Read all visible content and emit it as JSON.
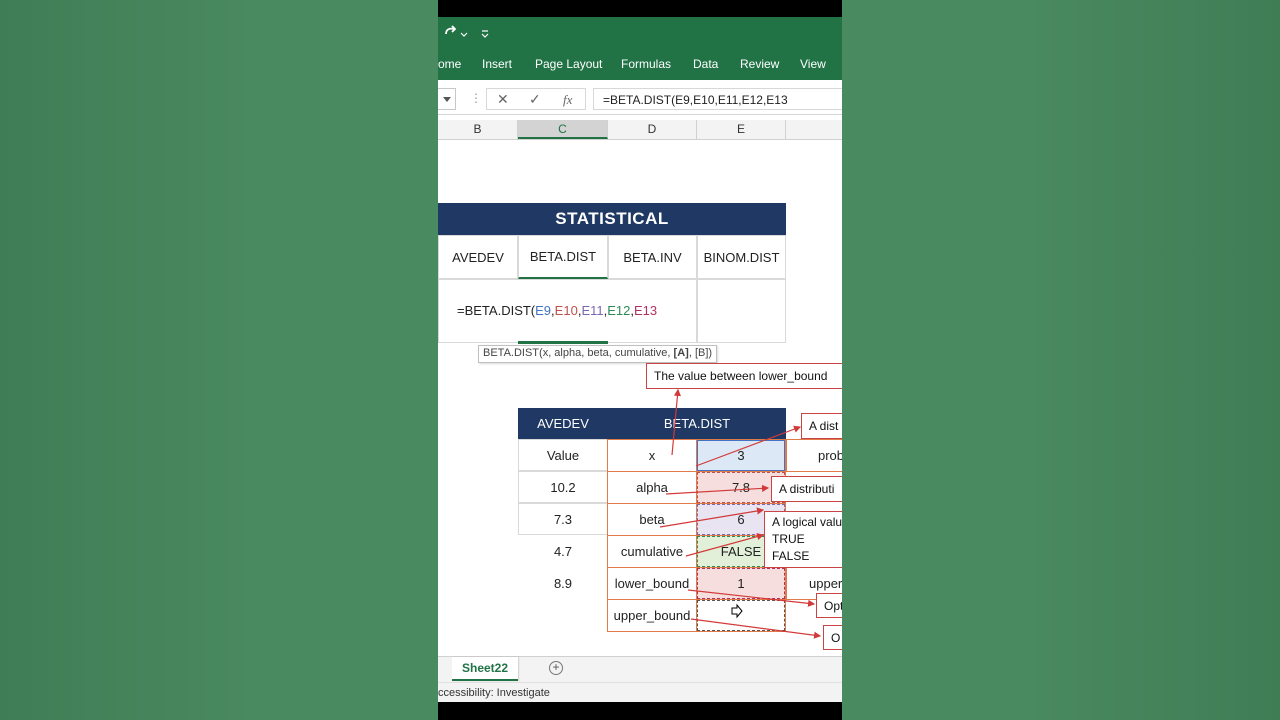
{
  "quick_access": {
    "redo_icon": "redo-icon",
    "dropdown_icon": "chevron-down-icon",
    "customize_icon": "customize-icon"
  },
  "ribbon": {
    "tabs": [
      "ome",
      "Insert",
      "Page Layout",
      "Formulas",
      "Data",
      "Review",
      "View"
    ]
  },
  "formula_bar": {
    "cancel_glyph": "✕",
    "enter_glyph": "✓",
    "fx_glyph": "fx",
    "formula": "=BETA.DIST(E9,E10,E11,E12,E13"
  },
  "columns": [
    "B",
    "C",
    "D",
    "E"
  ],
  "table1": {
    "title": "STATISTICAL",
    "headers": [
      "AVEDEV",
      "BETA.DIST",
      "BETA.INV",
      "BINOM.DIST"
    ],
    "formula_prefix": "=BETA.DIST(",
    "refs": [
      {
        "text": "E9",
        "color": "#4472c4"
      },
      {
        "text": ",",
        "color": "#222222"
      },
      {
        "text": "E10",
        "color": "#c0504d"
      },
      {
        "text": ",",
        "color": "#222222"
      },
      {
        "text": "E11",
        "color": "#7b68b0"
      },
      {
        "text": ",",
        "color": "#222222"
      },
      {
        "text": "E12",
        "color": "#2e8b57"
      },
      {
        "text": ",",
        "color": "#222222"
      },
      {
        "text": "E13",
        "color": "#b03060"
      }
    ]
  },
  "tooltip": {
    "prefix": "BETA.DIST(x, alpha, beta, cumulative, ",
    "bold": "[A]",
    "suffix": ", [B])"
  },
  "table2": {
    "header_left": "AVEDEV",
    "header_right": "BETA.DIST",
    "col_b": [
      "Value",
      "10.2",
      "7.3",
      "4.7",
      "8.9"
    ],
    "params": [
      "x",
      "alpha",
      "beta",
      "cumulative",
      "lower_bound",
      "upper_bound"
    ],
    "values": [
      "3",
      "7.8",
      "6",
      "FALSE",
      "1",
      ""
    ],
    "col_f": [
      "prob",
      "",
      "",
      "",
      "upper",
      ""
    ]
  },
  "callouts": {
    "c1": "The value between lower_bound",
    "c2": "A dist",
    "c3": "A distributi",
    "c4_lines": [
      "A logical valu",
      "TRUE",
      "FALSE"
    ],
    "c5": "Opt",
    "c6": "O"
  },
  "sheet": {
    "active_tab": "Sheet22",
    "add_glyph": "+"
  },
  "status": {
    "text": "ccessibility: Investigate"
  },
  "colors": {
    "excel_green": "#217346",
    "header_navy": "#1f3864",
    "cell_border": "#e07a46",
    "callout_border": "#c94545",
    "x_fill": "#dce8f5",
    "alpha_fill": "#f6dede",
    "beta_fill": "#e8e4f2",
    "cumulative_fill": "#e2f0d9",
    "lower_fill": "#f6dede"
  }
}
